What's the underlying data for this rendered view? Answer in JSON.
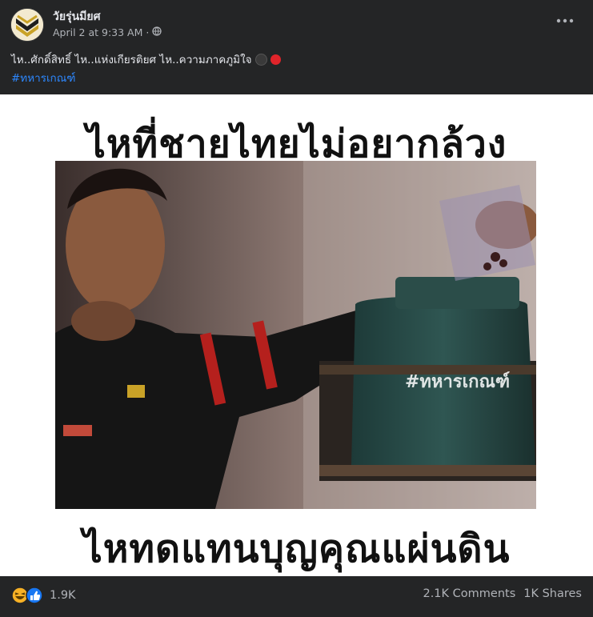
{
  "post": {
    "page_name": "วัยรุ่นมียศ",
    "timestamp": "April 2 at 9:33 AM",
    "separator": "·",
    "caption": "ไห..ศักดิ์สิทธิ์ ไห..แห่งเกียรติยศ ไห..ความภาคภูมิใจ",
    "hashtag": "#ทหารเกณฑ์"
  },
  "image": {
    "top_text": "ไหที่ชายไทยไม่อยากล้วง",
    "bottom_text": "ไหทดแทนบุญคุณแผ่นดิน",
    "watermark": "#ทหารเกณฑ์"
  },
  "footer": {
    "reaction_count": "1.9K",
    "comments": "2.1K Comments",
    "shares": "1K Shares"
  },
  "colors": {
    "background": "#242526",
    "text": "#e4e6eb",
    "muted": "#b0b3b8",
    "link": "#2d88ff",
    "like": "#1877f2",
    "haha": "#f7b125"
  },
  "icons": [
    "globe-icon",
    "more-icon",
    "black-circle-icon",
    "red-circle-icon",
    "haha-reaction-icon",
    "like-reaction-icon"
  ]
}
